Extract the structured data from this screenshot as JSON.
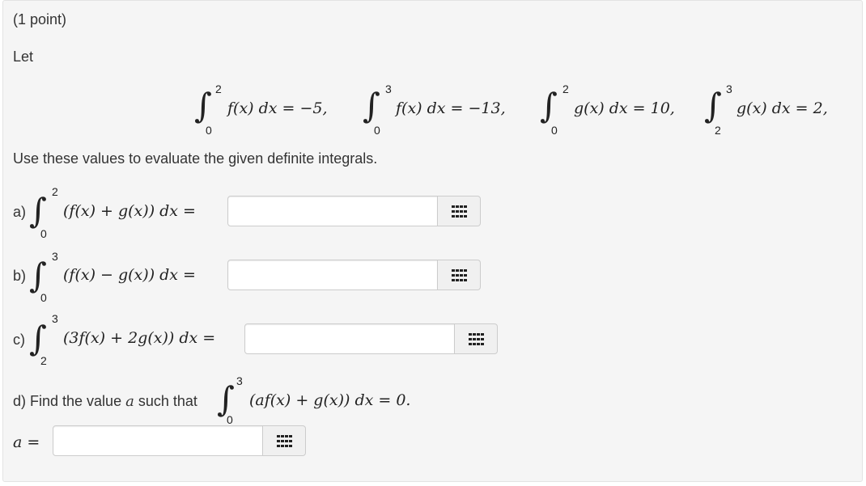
{
  "header": {
    "points": "(1 point)"
  },
  "intro": {
    "let": "Let"
  },
  "given": [
    {
      "lower": "0",
      "upper": "2",
      "expr": "f(x) dx = −5,"
    },
    {
      "lower": "0",
      "upper": "3",
      "expr": "f(x) dx = −13,"
    },
    {
      "lower": "0",
      "upper": "2",
      "expr": "g(x) dx = 10,"
    },
    {
      "lower": "2",
      "upper": "3",
      "expr": "g(x) dx = 2,"
    }
  ],
  "instruction": "Use these values to evaluate the given definite integrals.",
  "parts": [
    {
      "label": "a)",
      "lower": "0",
      "upper": "2",
      "expr": "(f(x) + g(x)) dx =",
      "answer": ""
    },
    {
      "label": "b)",
      "lower": "0",
      "upper": "3",
      "expr": "(f(x) − g(x)) dx =",
      "answer": ""
    },
    {
      "label": "c)",
      "lower": "2",
      "upper": "3",
      "expr": "(3f(x) + 2g(x)) dx =",
      "answer": ""
    }
  ],
  "part_d": {
    "text": "d) Find the value",
    "var": "a",
    "text2": "such that",
    "lower": "0",
    "upper": "3",
    "expr": "(af(x) + g(x)) dx = 0.",
    "answer_label": "a =",
    "answer": ""
  },
  "icons": {
    "keyboard": "equation-editor-grid-icon"
  }
}
